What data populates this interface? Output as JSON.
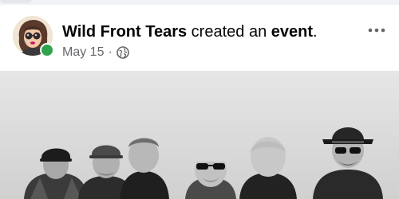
{
  "post": {
    "author": "Wild Front Tears",
    "action_text": " created an ",
    "object_text": "event",
    "punctuation": ".",
    "date": "May 15",
    "separator": "·",
    "privacy_icon": "globe-icon",
    "options_icon": "more-horizontal-icon"
  },
  "avatar": {
    "online": true,
    "online_color": "#31a24c"
  },
  "image": {
    "description_icon": "band-photo"
  },
  "colors": {
    "text_primary": "#050505",
    "text_secondary": "#65676b",
    "background": "#f0f2f5",
    "card": "#ffffff"
  }
}
